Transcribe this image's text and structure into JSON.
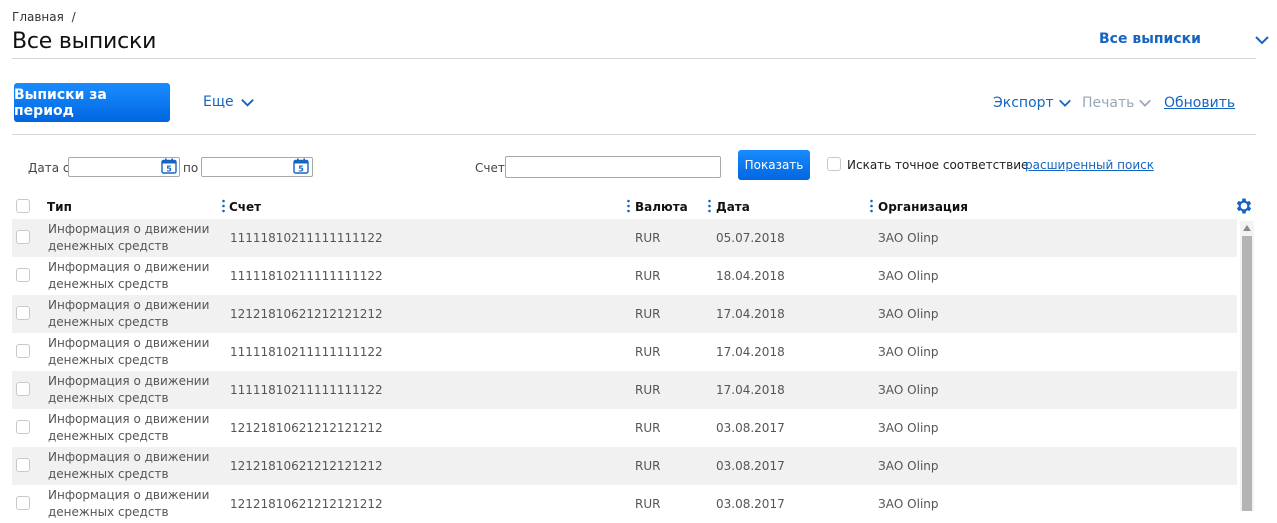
{
  "breadcrumb": {
    "home": "Главная",
    "separator": "/"
  },
  "page_title": "Все выписки",
  "view_selector": {
    "label": "Все выписки"
  },
  "toolbar": {
    "period_button": "Выписки за период",
    "more": "Еще",
    "export": "Экспорт",
    "print": "Печать",
    "refresh": "Обновить"
  },
  "filters": {
    "date_from_label": "Дата с",
    "date_to_label": "по",
    "date_from_value": "",
    "date_to_value": "",
    "account_label": "Счет",
    "account_value": "",
    "show_button": "Показать",
    "exact_match_label": "Искать точное соответствие",
    "advanced_search": "расширенный поиск"
  },
  "table": {
    "columns": [
      "Тип",
      "Счет",
      "Валюта",
      "Дата",
      "Организация"
    ],
    "rows": [
      {
        "type": "Информация о движении денежных средств",
        "account": "11111810211111111122",
        "currency": "RUR",
        "date": "05.07.2018",
        "org": "ЗАО Olinp"
      },
      {
        "type": "Информация о движении денежных средств",
        "account": "11111810211111111122",
        "currency": "RUR",
        "date": "18.04.2018",
        "org": "ЗАО Olinp"
      },
      {
        "type": "Информация о движении денежных средств",
        "account": "12121810621212121212",
        "currency": "RUR",
        "date": "17.04.2018",
        "org": "ЗАО Olinp"
      },
      {
        "type": "Информация о движении денежных средств",
        "account": "11111810211111111122",
        "currency": "RUR",
        "date": "17.04.2018",
        "org": "ЗАО Olinp"
      },
      {
        "type": "Информация о движении денежных средств",
        "account": "11111810211111111122",
        "currency": "RUR",
        "date": "17.04.2018",
        "org": "ЗАО Olinp"
      },
      {
        "type": "Информация о движении денежных средств",
        "account": "12121810621212121212",
        "currency": "RUR",
        "date": "03.08.2017",
        "org": "ЗАО Olinp"
      },
      {
        "type": "Информация о движении денежных средств",
        "account": "12121810621212121212",
        "currency": "RUR",
        "date": "03.08.2017",
        "org": "ЗАО Olinp"
      },
      {
        "type": "Информация о движении денежных средств",
        "account": "12121810621212121212",
        "currency": "RUR",
        "date": "03.08.2017",
        "org": "ЗАО Olinp"
      }
    ]
  },
  "icons": {
    "chevron": "chevron-down-icon",
    "calendar": "calendar-icon",
    "settings": "gear-icon",
    "column_menu": "column-dots-icon"
  },
  "colors": {
    "accent": "#1565c0",
    "primary_button": "#0a7af0",
    "disabled": "#9aa7b5",
    "row_stripe": "#f1f1f1"
  }
}
